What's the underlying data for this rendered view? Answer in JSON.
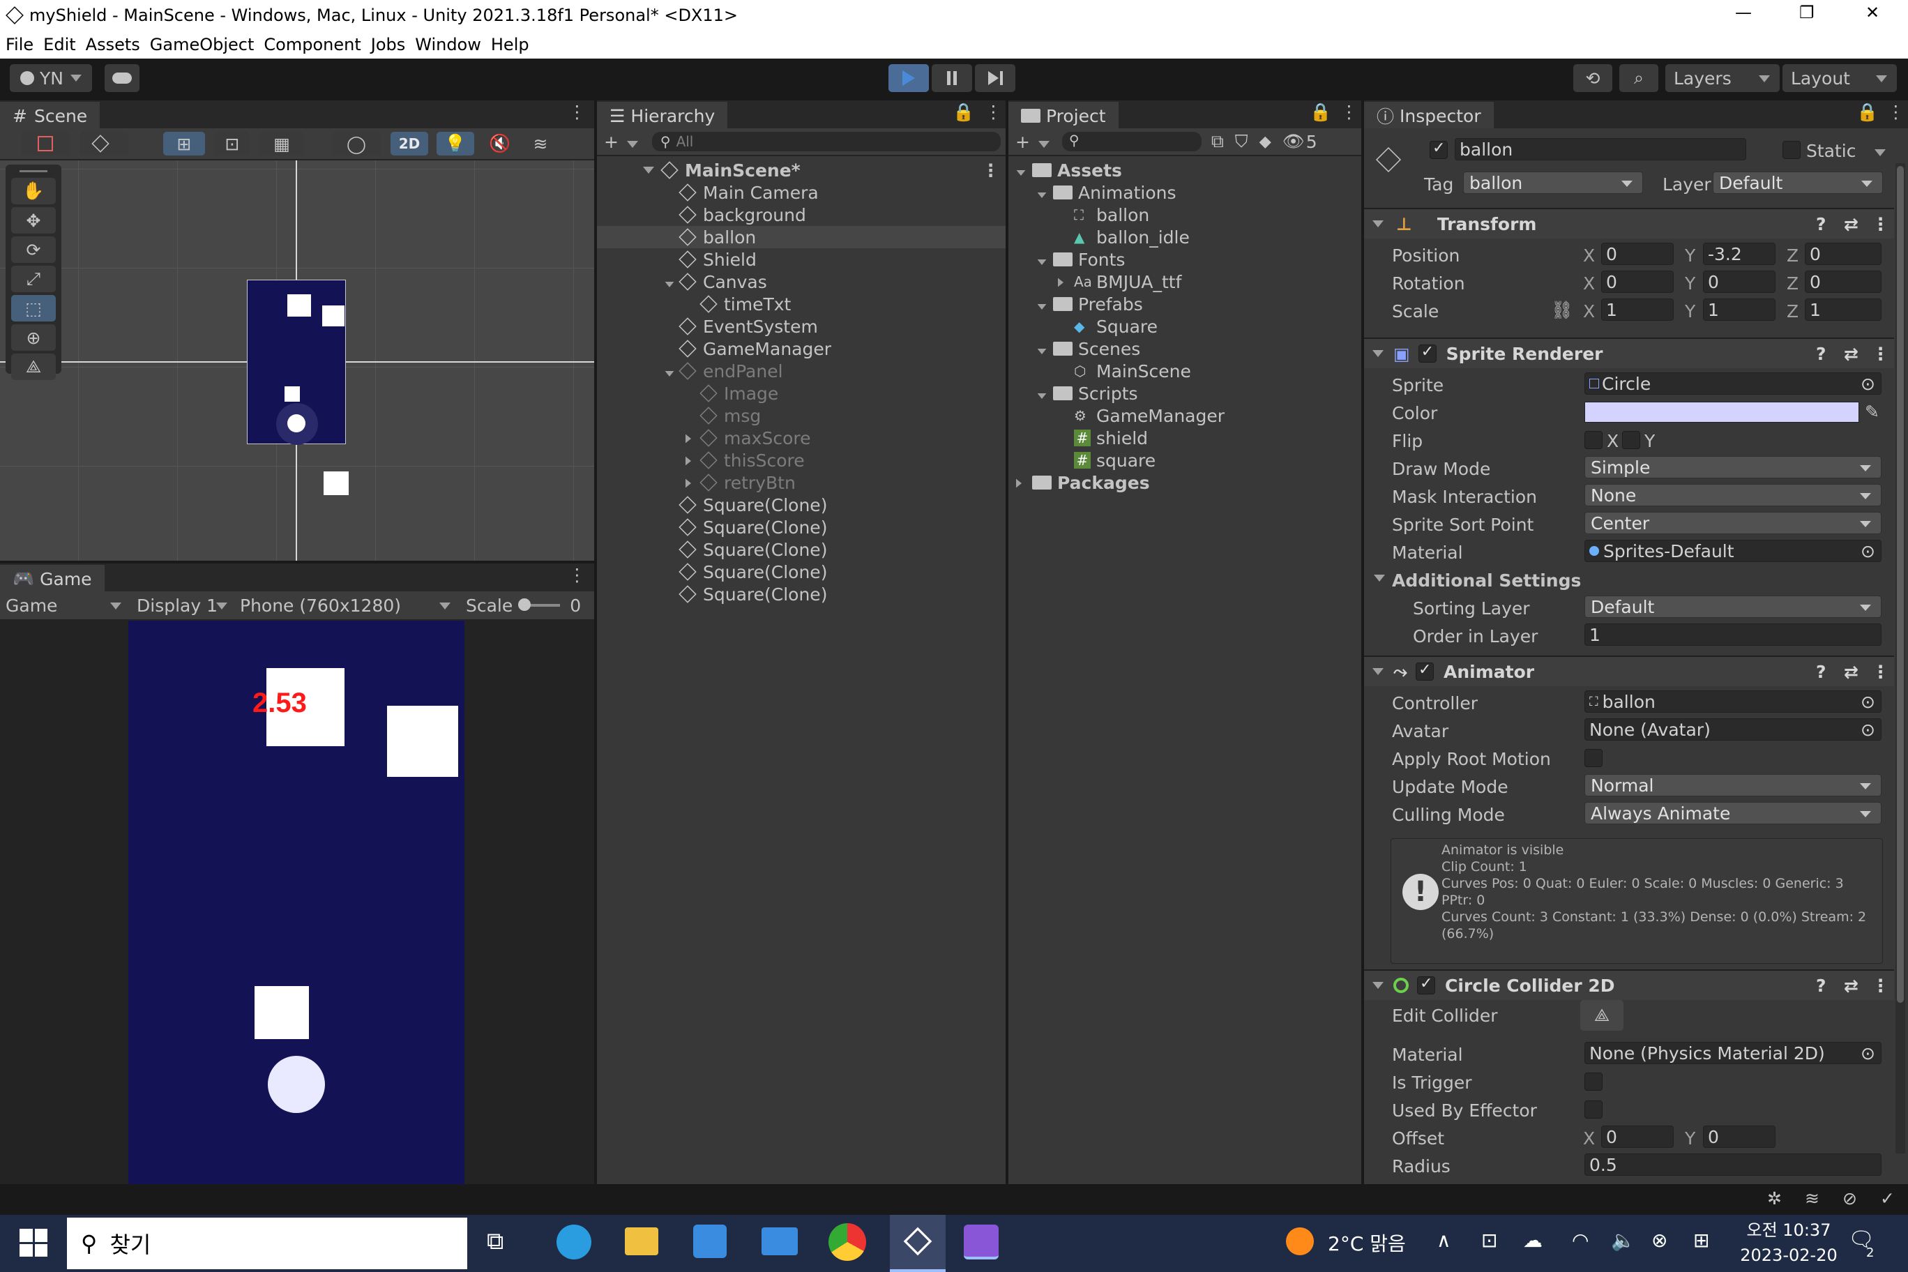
{
  "window": {
    "title": "myShield - MainScene - Windows, Mac, Linux - Unity 2021.3.18f1 Personal* <DX11>",
    "min": "—",
    "max": "❐",
    "close": "✕"
  },
  "menu": [
    "File",
    "Edit",
    "Assets",
    "GameObject",
    "Component",
    "Jobs",
    "Window",
    "Help"
  ],
  "toolbar": {
    "account": "YN",
    "layers": "Layers",
    "layout": "Layout"
  },
  "scene": {
    "tab": "Scene",
    "mode_2d": "2D"
  },
  "game": {
    "tab": "Game",
    "view": "Game",
    "display": "Display 1",
    "resolution": "Phone (760x1280)",
    "scale_label": "Scale",
    "scale_value": "0",
    "timer": "2.53"
  },
  "hierarchy": {
    "tab": "Hierarchy",
    "search_placeholder": "All",
    "scene": "MainScene*",
    "items": [
      {
        "label": "Main Camera",
        "indent": 1,
        "dim": false,
        "fold": ""
      },
      {
        "label": "background",
        "indent": 1,
        "dim": false,
        "fold": ""
      },
      {
        "label": "ballon",
        "indent": 1,
        "dim": false,
        "fold": "",
        "selected": true
      },
      {
        "label": "Shield",
        "indent": 1,
        "dim": false,
        "fold": ""
      },
      {
        "label": "Canvas",
        "indent": 1,
        "dim": false,
        "fold": "open"
      },
      {
        "label": "timeTxt",
        "indent": 2,
        "dim": false,
        "fold": ""
      },
      {
        "label": "EventSystem",
        "indent": 1,
        "dim": false,
        "fold": ""
      },
      {
        "label": "GameManager",
        "indent": 1,
        "dim": false,
        "fold": ""
      },
      {
        "label": "endPanel",
        "indent": 1,
        "dim": true,
        "fold": "open"
      },
      {
        "label": "Image",
        "indent": 2,
        "dim": true,
        "fold": ""
      },
      {
        "label": "msg",
        "indent": 2,
        "dim": true,
        "fold": ""
      },
      {
        "label": "maxScore",
        "indent": 2,
        "dim": true,
        "fold": "closed"
      },
      {
        "label": "thisScore",
        "indent": 2,
        "dim": true,
        "fold": "closed"
      },
      {
        "label": "retryBtn",
        "indent": 2,
        "dim": true,
        "fold": "closed"
      },
      {
        "label": "Square(Clone)",
        "indent": 1,
        "dim": false,
        "fold": ""
      },
      {
        "label": "Square(Clone)",
        "indent": 1,
        "dim": false,
        "fold": ""
      },
      {
        "label": "Square(Clone)",
        "indent": 1,
        "dim": false,
        "fold": ""
      },
      {
        "label": "Square(Clone)",
        "indent": 1,
        "dim": false,
        "fold": ""
      },
      {
        "label": "Square(Clone)",
        "indent": 1,
        "dim": false,
        "fold": ""
      }
    ]
  },
  "project": {
    "tab": "Project",
    "hidden_count": "5",
    "items": [
      {
        "label": "Assets",
        "indent": 0,
        "type": "folder",
        "fold": "open",
        "bold": true
      },
      {
        "label": "Animations",
        "indent": 1,
        "type": "folder",
        "fold": "open"
      },
      {
        "label": "ballon",
        "indent": 2,
        "type": "controller",
        "fold": ""
      },
      {
        "label": "ballon_idle",
        "indent": 2,
        "type": "anim",
        "fold": ""
      },
      {
        "label": "Fonts",
        "indent": 1,
        "type": "folder",
        "fold": "open"
      },
      {
        "label": "BMJUA_ttf",
        "indent": 2,
        "type": "font",
        "fold": "closed"
      },
      {
        "label": "Prefabs",
        "indent": 1,
        "type": "folder",
        "fold": "open"
      },
      {
        "label": "Square",
        "indent": 2,
        "type": "prefab",
        "fold": ""
      },
      {
        "label": "Scenes",
        "indent": 1,
        "type": "folder",
        "fold": "open"
      },
      {
        "label": "MainScene",
        "indent": 2,
        "type": "scene",
        "fold": ""
      },
      {
        "label": "Scripts",
        "indent": 1,
        "type": "folder",
        "fold": "open"
      },
      {
        "label": "GameManager",
        "indent": 2,
        "type": "gear",
        "fold": ""
      },
      {
        "label": "shield",
        "indent": 2,
        "type": "script",
        "fold": ""
      },
      {
        "label": "square",
        "indent": 2,
        "type": "script",
        "fold": ""
      },
      {
        "label": "Packages",
        "indent": 0,
        "type": "folder",
        "fold": "closed",
        "bold": true
      }
    ]
  },
  "inspector": {
    "tab": "Inspector",
    "name": "ballon",
    "static": "Static",
    "tag_label": "Tag",
    "tag": "ballon",
    "layer_label": "Layer",
    "layer": "Default",
    "transform": {
      "title": "Transform",
      "position": "Position",
      "rotation": "Rotation",
      "scale": "Scale",
      "pos": [
        "0",
        "-3.2",
        "0"
      ],
      "rot": [
        "0",
        "0",
        "0"
      ],
      "scl": [
        "1",
        "1",
        "1"
      ]
    },
    "sprite_renderer": {
      "title": "Sprite Renderer",
      "sprite_l": "Sprite",
      "sprite": "Circle",
      "color_l": "Color",
      "color": "#d4d3ff",
      "flip_l": "Flip",
      "drawmode_l": "Draw Mode",
      "drawmode": "Simple",
      "mask_l": "Mask Interaction",
      "mask": "None",
      "sortpoint_l": "Sprite Sort Point",
      "sortpoint": "Center",
      "material_l": "Material",
      "material": "Sprites-Default",
      "additional": "Additional Settings",
      "sortlayer_l": "Sorting Layer",
      "sortlayer": "Default",
      "order_l": "Order in Layer",
      "order": "1"
    },
    "animator": {
      "title": "Animator",
      "controller_l": "Controller",
      "controller": "ballon",
      "avatar_l": "Avatar",
      "avatar": "None (Avatar)",
      "rootmotion_l": "Apply Root Motion",
      "update_l": "Update Mode",
      "update": "Normal",
      "culling_l": "Culling Mode",
      "culling": "Always Animate",
      "info": [
        "Animator is visible",
        "Clip Count: 1",
        "Curves Pos: 0 Quat: 0 Euler: 0 Scale: 0 Muscles: 0 Generic: 3",
        "PPtr: 0",
        "Curves Count: 3 Constant: 1 (33.3%) Dense: 0 (0.0%) Stream: 2",
        "(66.7%)"
      ]
    },
    "collider": {
      "title": "Circle Collider 2D",
      "edit_l": "Edit Collider",
      "material_l": "Material",
      "material": "None (Physics Material 2D)",
      "trigger_l": "Is Trigger",
      "effector_l": "Used By Effector",
      "offset_l": "Offset",
      "offset": [
        "0",
        "0"
      ],
      "radius_l": "Radius",
      "radius": "0.5"
    }
  },
  "taskbar": {
    "search": "찾기",
    "weather": "2°C 맑음",
    "time": "오전 10:37",
    "date": "2023-02-20",
    "notif": "2"
  },
  "colors": {
    "game_bg": "#131254",
    "play_accent": "#4b8ad6",
    "timer": "#ff1a1a",
    "ball": "#e9e9ff"
  }
}
